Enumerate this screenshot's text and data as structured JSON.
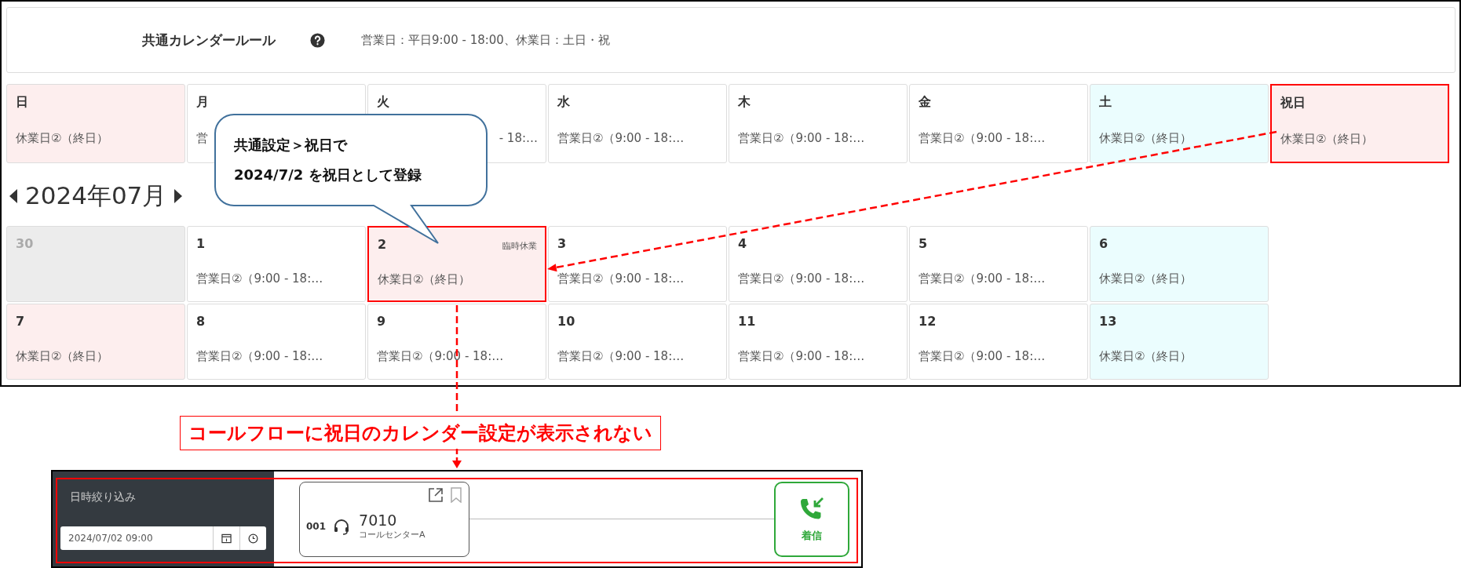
{
  "rule": {
    "title": "共通カレンダールール",
    "text": "営業日：平日9:00 - 18:00、休業日：土日・祝"
  },
  "weekdays": [
    {
      "label": "日",
      "text": "休業日②（終日）",
      "kind": "holiday",
      "highlighted": false
    },
    {
      "label": "月",
      "text": "営",
      "kind": "weekday",
      "highlighted": false
    },
    {
      "label": "火",
      "text": "- 18:…",
      "kind": "weekday",
      "highlighted": false,
      "covered": true
    },
    {
      "label": "水",
      "text": "営業日②（9:00 - 18:…",
      "kind": "weekday",
      "highlighted": false
    },
    {
      "label": "木",
      "text": "営業日②（9:00 - 18:…",
      "kind": "weekday",
      "highlighted": false
    },
    {
      "label": "金",
      "text": "営業日②（9:00 - 18:…",
      "kind": "weekday",
      "highlighted": false
    },
    {
      "label": "土",
      "text": "休業日②（終日）",
      "kind": "saturday",
      "highlighted": false
    },
    {
      "label": "祝日",
      "text": "休業日②（終日）",
      "kind": "holiday",
      "highlighted": true
    }
  ],
  "callout": {
    "lines": [
      "共通設定＞祝日で",
      "2024/7/2 を祝日として登録"
    ]
  },
  "month": {
    "title": "2024年07月"
  },
  "weeks": [
    [
      {
        "label": "30",
        "kind": "other",
        "highlighted": false
      },
      {
        "label": "1",
        "text": "営業日②（9:00 - 18:…",
        "kind": "weekday",
        "highlighted": false
      },
      {
        "label": "2",
        "tag": "臨時休業",
        "text": "休業日②（終日）",
        "kind": "holiday",
        "highlighted": true
      },
      {
        "label": "3",
        "text": "営業日②（9:00 - 18:…",
        "kind": "weekday",
        "highlighted": false
      },
      {
        "label": "4",
        "text": "営業日②（9:00 - 18:…",
        "kind": "weekday",
        "highlighted": false
      },
      {
        "label": "5",
        "text": "営業日②（9:00 - 18:…",
        "kind": "weekday",
        "highlighted": false
      },
      {
        "label": "6",
        "text": "休業日②（終日）",
        "kind": "saturday",
        "highlighted": false
      }
    ],
    [
      {
        "label": "7",
        "text": "休業日②（終日）",
        "kind": "holiday",
        "highlighted": false
      },
      {
        "label": "8",
        "text": "営業日②（9:00 - 18:…",
        "kind": "weekday",
        "highlighted": false
      },
      {
        "label": "9",
        "text": "営業日②（9:00 - 18:…",
        "kind": "weekday",
        "highlighted": false
      },
      {
        "label": "10",
        "text": "営業日②（9:00 - 18:…",
        "kind": "weekday",
        "highlighted": false
      },
      {
        "label": "11",
        "text": "営業日②（9:00 - 18:…",
        "kind": "weekday",
        "highlighted": false
      },
      {
        "label": "12",
        "text": "営業日②（9:00 - 18:…",
        "kind": "weekday",
        "highlighted": false
      },
      {
        "label": "13",
        "text": "休業日②（終日）",
        "kind": "saturday",
        "highlighted": false
      }
    ]
  ],
  "note": "コールフローに祝日のカレンダー設定が表示されない",
  "callflow": {
    "filter_label": "日時絞り込み",
    "datetime": "2024/07/02 09:00",
    "node": {
      "number": "001",
      "extension": "7010",
      "name": "コールセンターA"
    },
    "end_node": {
      "label": "着信"
    }
  }
}
